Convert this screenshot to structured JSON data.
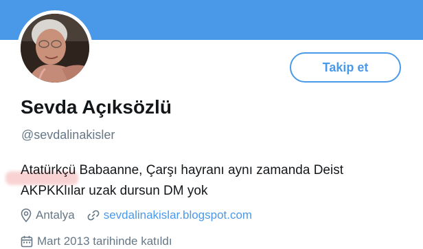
{
  "profile": {
    "display_name": "Sevda Açıksözlü",
    "handle": "@sevdalinakisler",
    "follow_label": "Takip et",
    "bio_highlight": "Atatürkçü",
    "bio_line1_rest": " Babaanne, Çarşı hayranı aynı zamanda Deist",
    "bio_line2": "AKPKKlılar uzak dursun DM yok",
    "location": "Antalya",
    "website": "sevdalinakislar.blogspot.com",
    "joined": "Mart 2013 tarihinde katıldı"
  },
  "icons": {
    "location": "location-pin-icon",
    "link": "link-icon",
    "calendar": "calendar-icon"
  },
  "colors": {
    "banner": "#4a99e9",
    "accent": "#4a99e9",
    "secondary_text": "#657786"
  }
}
